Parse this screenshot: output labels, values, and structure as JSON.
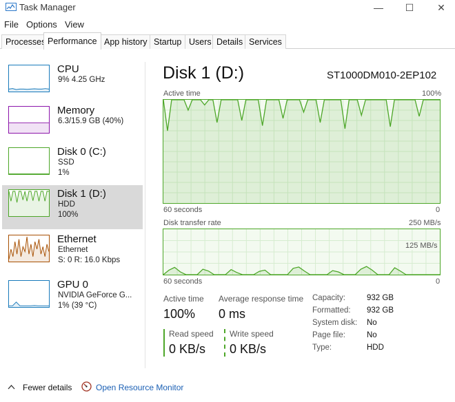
{
  "window": {
    "title": "Task Manager",
    "controls": {
      "minimize": "—",
      "maximize": "☐",
      "close": "✕"
    }
  },
  "menu": [
    "File",
    "Options",
    "View"
  ],
  "tabs": [
    {
      "label": "Processes",
      "active": false
    },
    {
      "label": "Performance",
      "active": true
    },
    {
      "label": "App history",
      "active": false
    },
    {
      "label": "Startup",
      "active": false
    },
    {
      "label": "Users",
      "active": false
    },
    {
      "label": "Details",
      "active": false
    },
    {
      "label": "Services",
      "active": false
    }
  ],
  "sidebar": {
    "items": [
      {
        "title": "CPU",
        "line1": "9% 4.25 GHz",
        "line2": "",
        "color": "#1779ba",
        "selected": false,
        "trace": [
          0.1,
          0.12,
          0.08,
          0.1,
          0.1,
          0.09,
          0.1,
          0.11,
          0.1,
          0.1,
          0.12,
          0.1
        ]
      },
      {
        "title": "Memory",
        "line1": "6.3/15.9 GB (40%)",
        "line2": "",
        "color": "#8b13aa",
        "selected": false,
        "trace": [
          0.4,
          0.4,
          0.4,
          0.4,
          0.4,
          0.4,
          0.4,
          0.4,
          0.4,
          0.4,
          0.4,
          0.4
        ]
      },
      {
        "title": "Disk 0 (C:)",
        "line1": "SSD",
        "line2": "1%",
        "color": "#4ca627",
        "selected": false,
        "trace": [
          0.01,
          0.01,
          0.01,
          0.01,
          0.01,
          0.01,
          0.01,
          0.01,
          0.01,
          0.01,
          0.01,
          0.01
        ]
      },
      {
        "title": "Disk 1 (D:)",
        "line1": "HDD",
        "line2": "100%",
        "color": "#4ca627",
        "selected": true,
        "trace": [
          1,
          0.6,
          1,
          1,
          0.55,
          1,
          1,
          0.65,
          1,
          0.6,
          1,
          1,
          0.62,
          1,
          1,
          0.6,
          1,
          1,
          0.6,
          1,
          1
        ]
      },
      {
        "title": "Ethernet",
        "line1": "Ethernet",
        "line2": "S: 0  R: 16.0 Kbps",
        "color": "#a74f01",
        "selected": false,
        "trace": [
          0.1,
          0.5,
          0.2,
          0.8,
          0.3,
          0.9,
          0.2,
          0.6,
          0.4,
          1,
          0.3,
          0.7,
          0.2,
          0.8,
          0.5,
          0.9,
          0.3,
          0.6,
          0.2,
          0.7,
          0.4
        ]
      },
      {
        "title": "GPU 0",
        "line1": "NVIDIA GeForce G...",
        "line2": "1% (39 °C)",
        "color": "#1779ba",
        "selected": false,
        "trace": [
          0.05,
          0.05,
          0.2,
          0.05,
          0.05,
          0.05,
          0.05,
          0.06,
          0.05,
          0.05,
          0.05,
          0.05
        ]
      }
    ]
  },
  "detail": {
    "title": "Disk 1 (D:)",
    "model": "ST1000DM010-2EP102",
    "active_time_chart": {
      "label": "Active time",
      "max_label": "100%",
      "x_left": "60 seconds",
      "x_right": "0",
      "values": [
        100,
        70,
        100,
        100,
        100,
        100,
        90,
        100,
        100,
        100,
        95,
        100,
        100,
        78,
        100,
        100,
        100,
        100,
        100,
        80,
        100,
        100,
        100,
        100,
        75,
        100,
        100,
        100,
        100,
        82,
        100,
        100,
        100,
        100,
        88,
        100,
        100,
        100,
        78,
        100,
        100,
        100,
        100,
        100,
        72,
        100,
        100,
        100,
        85,
        100,
        100,
        100,
        100,
        100,
        100,
        74,
        100,
        100,
        100,
        100,
        100,
        100,
        84,
        100,
        100,
        100,
        100,
        100
      ]
    },
    "transfer_chart": {
      "label": "Disk transfer rate",
      "max_label": "250 MB/s",
      "mid_label": "125 MB/s",
      "x_left": "60 seconds",
      "x_right": "0",
      "values": [
        0,
        25,
        40,
        15,
        0,
        0,
        0,
        30,
        20,
        0,
        0,
        0,
        28,
        12,
        0,
        0,
        0,
        18,
        25,
        0,
        0,
        0,
        0,
        35,
        42,
        20,
        0,
        0,
        0,
        0,
        22,
        15,
        0,
        0,
        0,
        30,
        45,
        25,
        0,
        0,
        0,
        38,
        20,
        0,
        0,
        0,
        0,
        0,
        0,
        0
      ]
    },
    "stats": {
      "active_time": {
        "label": "Active time",
        "value": "100%"
      },
      "avg_response": {
        "label": "Average response time",
        "value": "0 ms"
      },
      "read_speed": {
        "label": "Read speed",
        "value": "0 KB/s"
      },
      "write_speed": {
        "label": "Write speed",
        "value": "0 KB/s"
      }
    },
    "properties": [
      {
        "key": "Capacity:",
        "value": "932 GB"
      },
      {
        "key": "Formatted:",
        "value": "932 GB"
      },
      {
        "key": "System disk:",
        "value": "No"
      },
      {
        "key": "Page file:",
        "value": "No"
      },
      {
        "key": "Type:",
        "value": "HDD"
      }
    ]
  },
  "footer": {
    "fewer_details": "Fewer details",
    "open_resource_monitor": "Open Resource Monitor"
  },
  "colors": {
    "disk_green": "#4ca627",
    "disk_fill": "#e8f5e2",
    "grid": "#d6ecd0"
  }
}
